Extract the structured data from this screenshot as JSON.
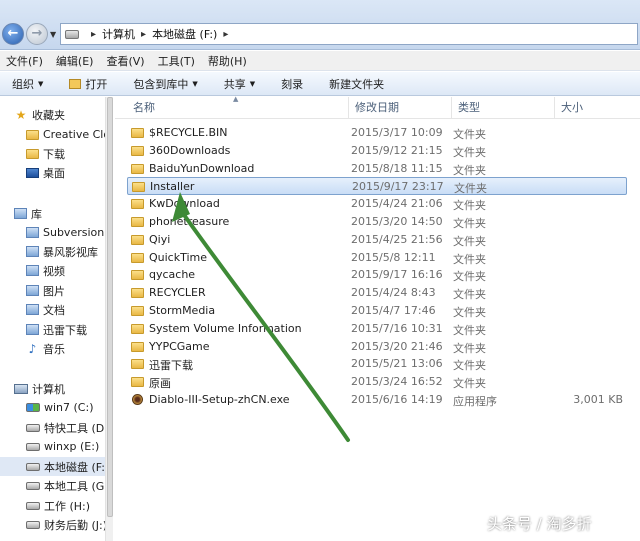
{
  "address": {
    "crumbs": [
      "计算机",
      "本地磁盘 (F:)"
    ]
  },
  "menu": [
    "文件(F)",
    "编辑(E)",
    "查看(V)",
    "工具(T)",
    "帮助(H)"
  ],
  "toolbar": {
    "organize": "组织",
    "open": "打开",
    "include_in_library": "包含到库中",
    "share": "共享",
    "burn": "刻录",
    "new_folder": "新建文件夹"
  },
  "nav": {
    "favorites": "收藏夹",
    "fav_items": [
      "Creative Cloud",
      "下载",
      "桌面"
    ],
    "libraries": "库",
    "lib_items": [
      "Subversion",
      "暴风影视库",
      "视频",
      "图片",
      "文档",
      "迅雷下载",
      "音乐"
    ],
    "computer": "计算机",
    "drives": [
      "win7 (C:)",
      "特快工具 (D:)",
      "winxp (E:)",
      "本地磁盘 (F:)",
      "本地工具 (G:)",
      "工作 (H:)",
      "财务后勤 (J:)"
    ]
  },
  "columns": {
    "name": "名称",
    "date": "修改日期",
    "type": "类型",
    "size": "大小"
  },
  "files": [
    {
      "name": "$RECYCLE.BIN",
      "date": "2015/3/17 10:09",
      "type": "文件夹",
      "size": ""
    },
    {
      "name": "360Downloads",
      "date": "2015/9/12 21:15",
      "type": "文件夹",
      "size": ""
    },
    {
      "name": "BaiduYunDownload",
      "date": "2015/8/18 11:15",
      "type": "文件夹",
      "size": ""
    },
    {
      "name": "Installer",
      "date": "2015/9/17 23:17",
      "type": "文件夹",
      "size": ""
    },
    {
      "name": "KwDownload",
      "date": "2015/4/24 21:06",
      "type": "文件夹",
      "size": ""
    },
    {
      "name": "phonetreasure",
      "date": "2015/3/20 14:50",
      "type": "文件夹",
      "size": ""
    },
    {
      "name": "Qiyi",
      "date": "2015/4/25 21:56",
      "type": "文件夹",
      "size": ""
    },
    {
      "name": "QuickTime",
      "date": "2015/5/8 12:11",
      "type": "文件夹",
      "size": ""
    },
    {
      "name": "qycache",
      "date": "2015/9/17 16:16",
      "type": "文件夹",
      "size": ""
    },
    {
      "name": "RECYCLER",
      "date": "2015/4/24 8:43",
      "type": "文件夹",
      "size": ""
    },
    {
      "name": "StormMedia",
      "date": "2015/4/7 17:46",
      "type": "文件夹",
      "size": ""
    },
    {
      "name": "System Volume Information",
      "date": "2015/7/16 10:31",
      "type": "文件夹",
      "size": ""
    },
    {
      "name": "YYPCGame",
      "date": "2015/3/20 21:46",
      "type": "文件夹",
      "size": ""
    },
    {
      "name": "迅雷下载",
      "date": "2015/5/21 13:06",
      "type": "文件夹",
      "size": ""
    },
    {
      "name": "原画",
      "date": "2015/3/24 16:52",
      "type": "文件夹",
      "size": ""
    },
    {
      "name": "Diablo-III-Setup-zhCN.exe",
      "date": "2015/6/16 14:19",
      "type": "应用程序",
      "size": "3,001 KB"
    }
  ],
  "watermark": "头条号 / 淘多折"
}
